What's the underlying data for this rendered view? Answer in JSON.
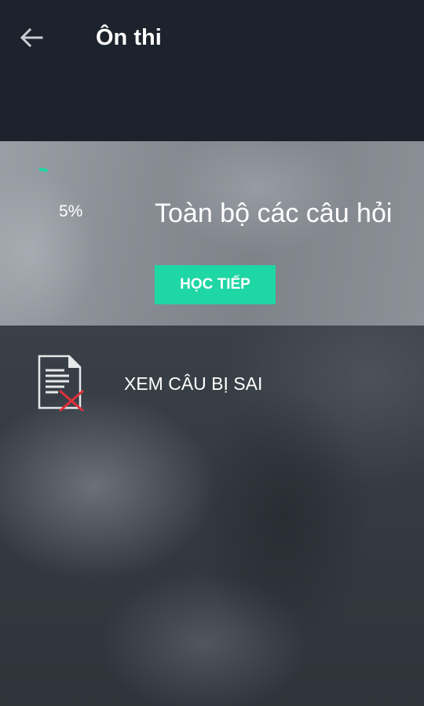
{
  "header": {
    "title": "Ôn thi",
    "back_icon": "arrow-left-icon",
    "background": "#1d232c"
  },
  "study_card": {
    "progress_percent": 5,
    "progress_label": "5%",
    "title": "Toàn bộ các câu hỏi",
    "continue_label": "HỌC TIẾP",
    "accent_color": "#1fd6a5"
  },
  "wrong_answers": {
    "label": "XEM CÂU BỊ SAI",
    "icon": "document-error-icon",
    "error_color": "#e0303b"
  }
}
